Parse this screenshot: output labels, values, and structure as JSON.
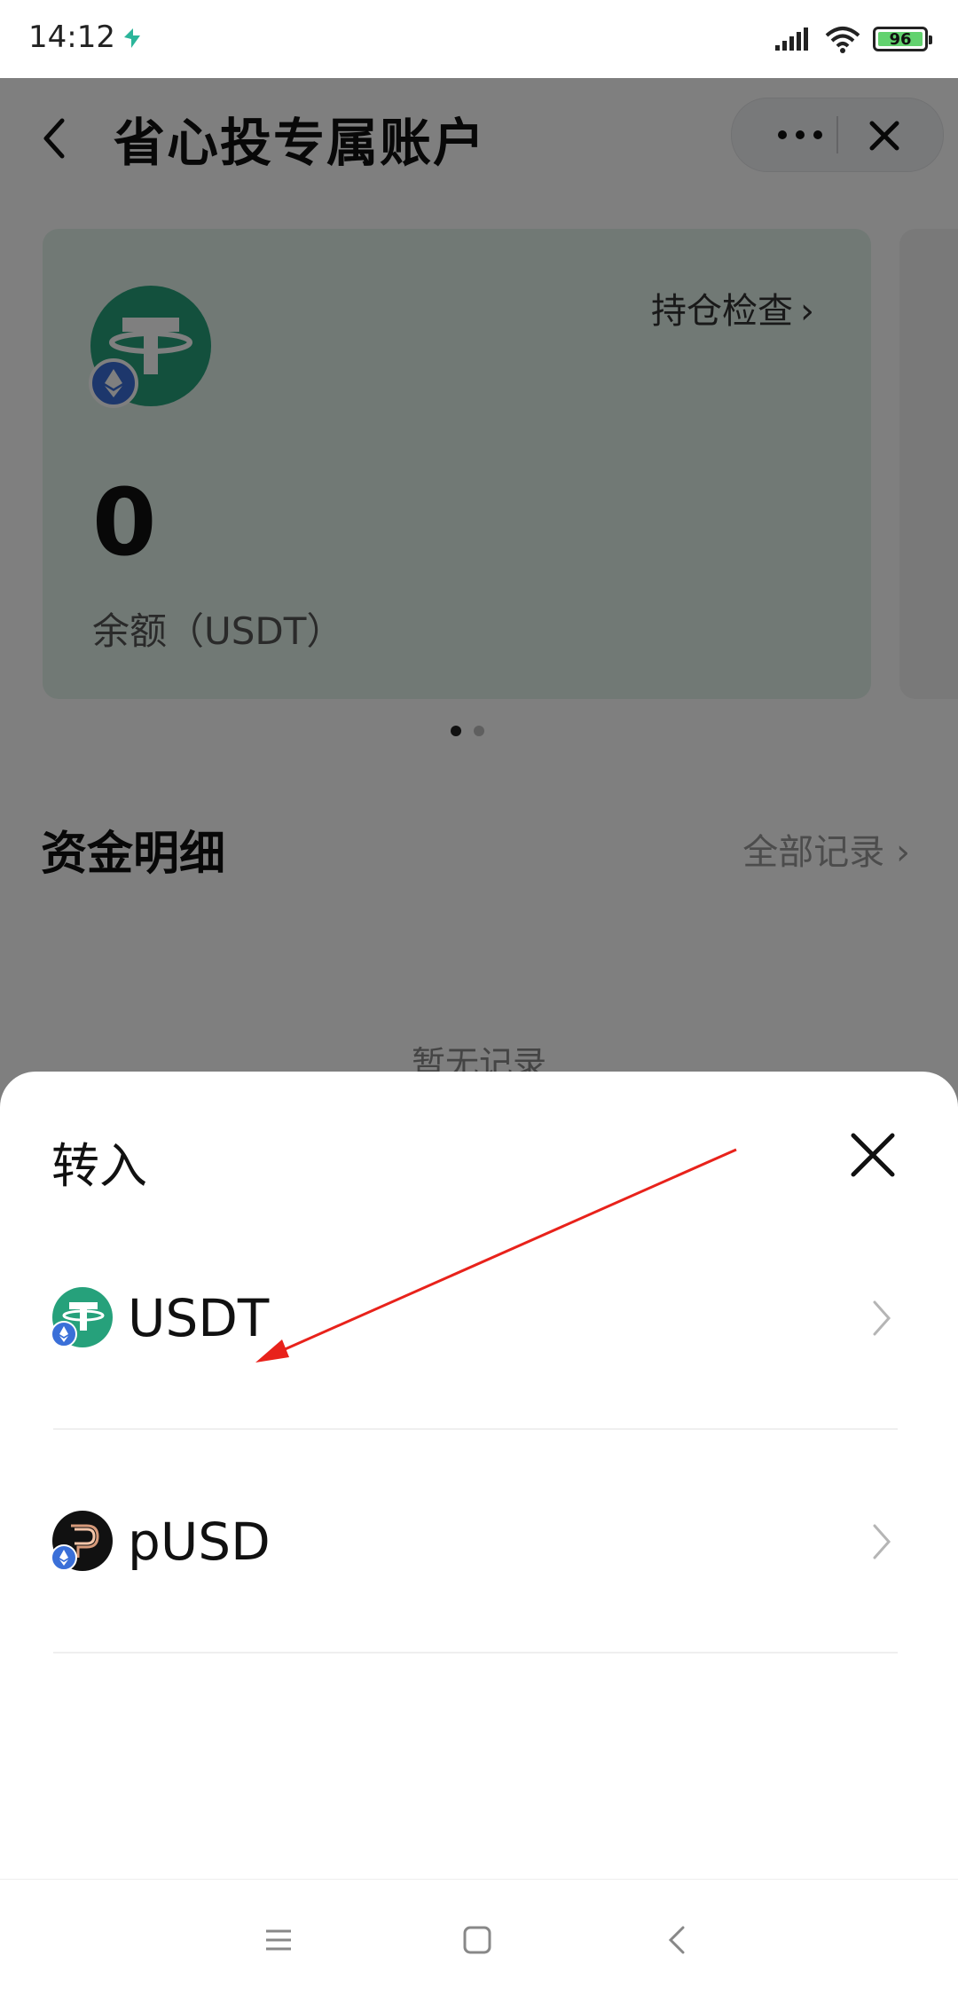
{
  "status_bar": {
    "time": "14:12",
    "battery": "96"
  },
  "header": {
    "title": "省心投专属账户"
  },
  "card": {
    "holdings_check": "持仓检查",
    "balance": "0",
    "balance_label": "余额（USDT）"
  },
  "funds": {
    "title": "资金明细",
    "all_records": "全部记录",
    "empty_text": "暂无记录"
  },
  "sheet": {
    "title": "转入",
    "items": [
      {
        "label": "USDT",
        "icon": "usdt-coin-icon"
      },
      {
        "label": "pUSD",
        "icon": "pusd-coin-icon"
      }
    ]
  },
  "colors": {
    "usdt_green": "#26a17b",
    "eth_badge_blue": "#3a6fd8",
    "annotation_red": "#e8221b",
    "card_bg": "#e3f2ea"
  }
}
